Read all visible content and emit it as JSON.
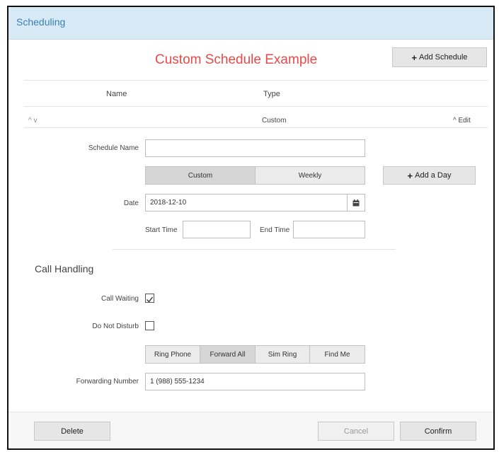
{
  "window": {
    "title": "Scheduling"
  },
  "header": {
    "title": "Custom Schedule Example",
    "add_schedule_label": "Add Schedule"
  },
  "table": {
    "columns": [
      "Name",
      "Type"
    ],
    "row": {
      "name_controls": "^ v",
      "type": "Custom",
      "edit_label": "Edit"
    }
  },
  "form": {
    "schedule_name_label": "Schedule Name",
    "schedule_name_value": "",
    "type_options": [
      "Custom",
      "Weekly"
    ],
    "selected_type": "Custom",
    "add_day_label": "Add a Day",
    "date_label": "Date",
    "date_value": "2018-12-10",
    "start_time_label": "Start Time",
    "start_time_value": "",
    "end_time_label": "End Time",
    "end_time_value": ""
  },
  "call_handling": {
    "title": "Call Handling",
    "call_waiting_label": "Call Waiting",
    "call_waiting_checked": true,
    "dnd_label": "Do Not Disturb",
    "dnd_checked": false,
    "options": [
      "Ring Phone",
      "Forward All",
      "Sim Ring",
      "Find Me"
    ],
    "selected_option": "Forward All",
    "forwarding_number_label": "Forwarding Number",
    "forwarding_number_value": "1 (988) 555-1234"
  },
  "footer": {
    "delete_label": "Delete",
    "cancel_label": "Cancel",
    "confirm_label": "Confirm"
  }
}
